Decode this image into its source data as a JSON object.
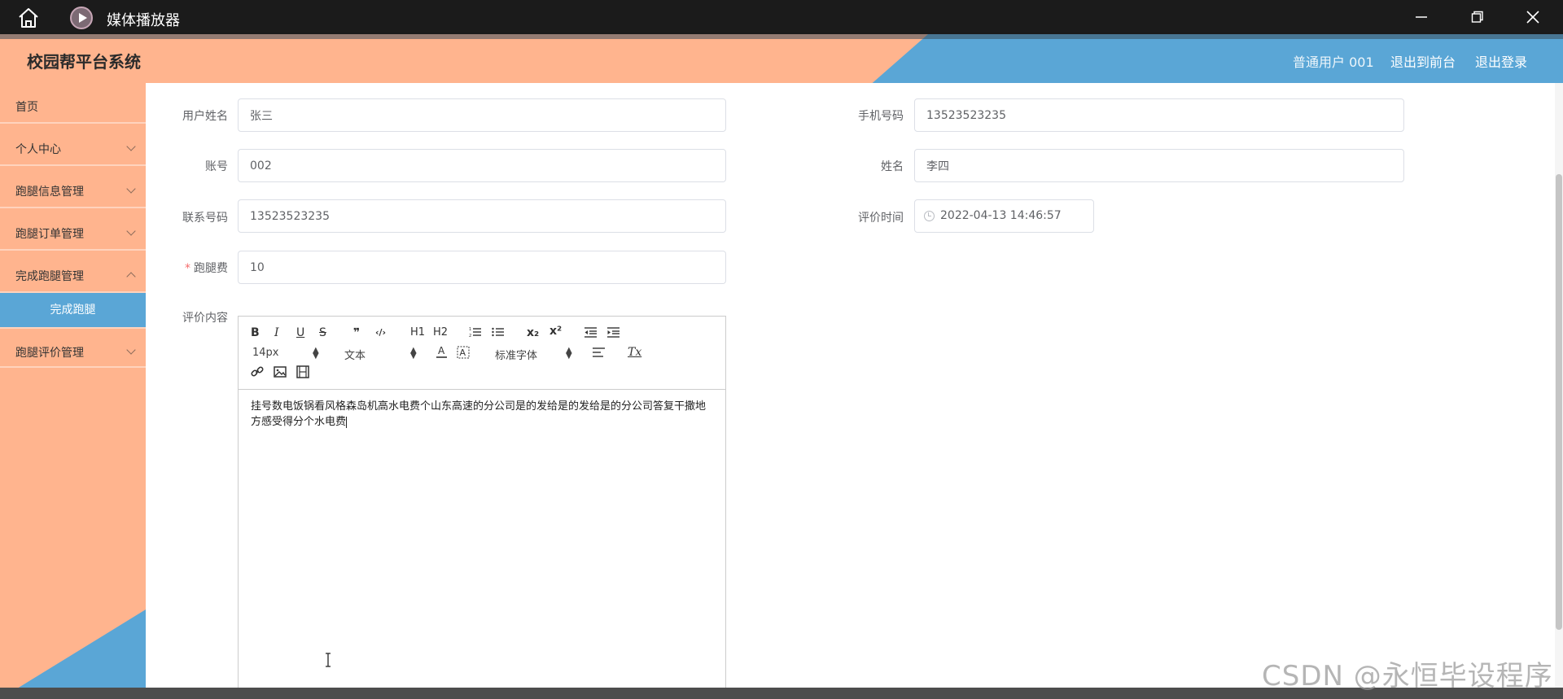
{
  "window": {
    "title": "媒体播放器"
  },
  "header": {
    "title": "校园帮平台系统",
    "user": "普通用户 001",
    "front": "退出到前台",
    "logout": "退出登录"
  },
  "sidebar": {
    "items": [
      {
        "label": "首页"
      },
      {
        "label": "个人中心"
      },
      {
        "label": "跑腿信息管理"
      },
      {
        "label": "跑腿订单管理"
      },
      {
        "label": "完成跑腿管理"
      },
      {
        "label": "跑腿评价管理"
      }
    ],
    "active_sub": "完成跑腿"
  },
  "form": {
    "username": {
      "label": "用户姓名",
      "value": "张三"
    },
    "phone": {
      "label": "手机号码",
      "value": "13523523235"
    },
    "account": {
      "label": "账号",
      "value": "002"
    },
    "name": {
      "label": "姓名",
      "value": "李四"
    },
    "contact": {
      "label": "联系号码",
      "value": "13523523235"
    },
    "review_time": {
      "label": "评价时间",
      "value": "2022-04-13 14:46:57"
    },
    "fee": {
      "label": "跑腿费",
      "required_mark": "*",
      "value": "10"
    },
    "content": {
      "label": "评价内容"
    }
  },
  "editor": {
    "toolbar": {
      "bold": "B",
      "italic": "I",
      "underline": "U",
      "strike": "S",
      "quote": "❞",
      "code": "‹/›",
      "h1": "H1",
      "h2": "H2",
      "sub": "x₂",
      "sup": "x²",
      "size": "14px",
      "header": "文本",
      "font": "标准字体",
      "clean": "Tx"
    },
    "content": "挂号数电饭锅看风格森岛机高水电费个山东高速的分公司是的发给是的发给是的分公司答复干撒地方感受得分个水电费"
  },
  "watermark": "CSDN @永恒毕设程序"
}
